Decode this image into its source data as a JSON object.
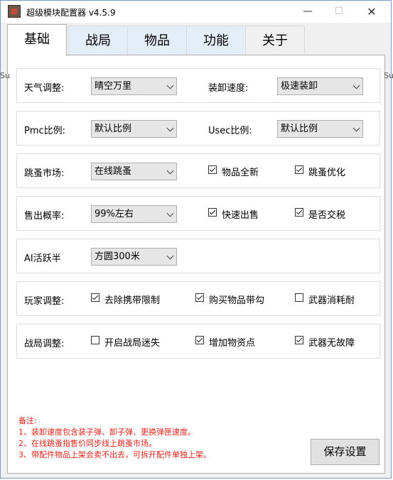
{
  "window": {
    "title": "超级模块配置器 v4.5.9",
    "minimize": "—",
    "maximize": "☐",
    "close": "✕"
  },
  "tabs": [
    "基础",
    "战局",
    "物品",
    "功能",
    "关于"
  ],
  "active_tab": "基础",
  "rows": {
    "weather": {
      "label": "天气调整:",
      "value": "晴空万里"
    },
    "load_speed": {
      "label": "装卸速度:",
      "value": "极速装卸"
    },
    "pmc": {
      "label": "Pmc比例:",
      "value": "默认比例"
    },
    "usec": {
      "label": "Usec比例:",
      "value": "默认比例"
    },
    "flea": {
      "label": "跳蚤市场:",
      "value": "在线跳蚤"
    },
    "item_new": {
      "label": "物品全新",
      "checked": true
    },
    "flea_opt": {
      "label": "跳蚤优化",
      "checked": true
    },
    "sell_rate": {
      "label": "售出概率:",
      "value": "99%左右"
    },
    "fast_sell": {
      "label": "快速出售",
      "checked": true
    },
    "tax": {
      "label": "是否交税",
      "checked": true
    },
    "ai": {
      "label": "AI活跃半",
      "value": "方圆300米"
    },
    "player": {
      "label": "玩家调整:"
    },
    "remove_limit": {
      "label": "去除携带限制",
      "checked": true
    },
    "buy_tick": {
      "label": "购买物品带勾",
      "checked": true
    },
    "weapon_wear": {
      "label": "武器消耗耐",
      "checked": false
    },
    "raid": {
      "label": "战局调整:"
    },
    "raid_lost": {
      "label": "开启战局迷失",
      "checked": false
    },
    "add_loot": {
      "label": "增加物资点",
      "checked": true
    },
    "no_malfunction": {
      "label": "武器无故障",
      "checked": true
    }
  },
  "notes": [
    "备注:",
    "1、装卸速度包含装子弹、卸子弹、更换弹匣速度。",
    "2、在线跳蚤指售价同步线上跳蚤市场。",
    "3、带配件物品上架会卖不出去，可拆开配件单独上架。"
  ],
  "save_label": "保存设置",
  "side": {
    "left_fragment": "Su",
    "right_fragment": "Su"
  },
  "colors": {
    "notes": "#e0241a",
    "tab_bg": "#e4eef9"
  }
}
